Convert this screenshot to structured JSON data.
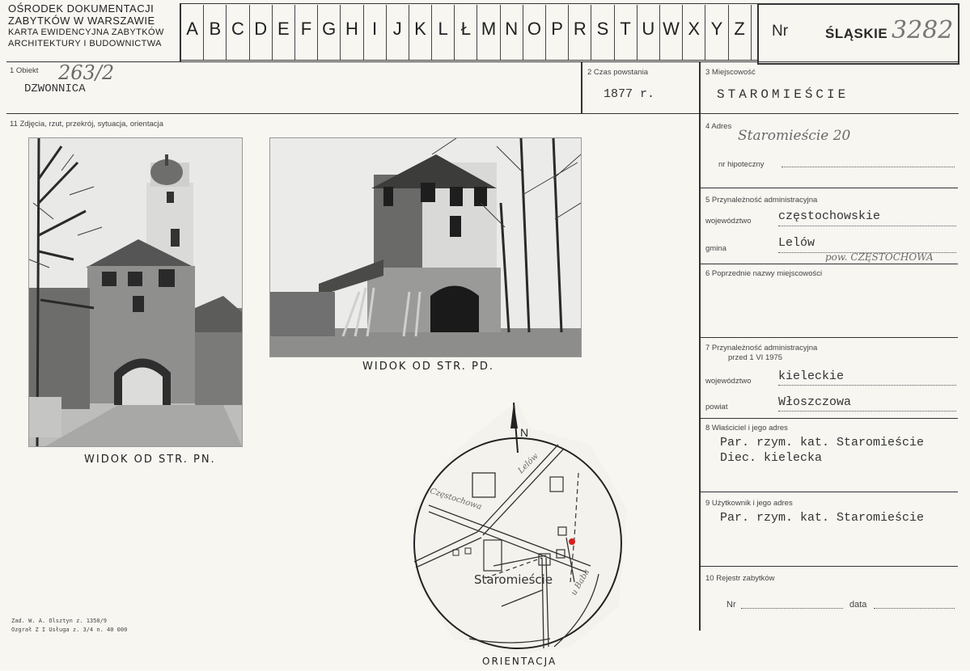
{
  "header": {
    "line1": "OŚRODEK DOKUMENTACJI",
    "line2": "ZABYTKÓW W WARSZAWIE",
    "line3": "KARTA EWIDENCYJNA ZABYTKÓW",
    "line4": "ARCHITEKTURY I BUDOWNICTWA"
  },
  "alphabet": [
    "A",
    "B",
    "C",
    "D",
    "E",
    "F",
    "G",
    "H",
    "I",
    "J",
    "K",
    "L",
    "Ł",
    "M",
    "N",
    "O",
    "P",
    "R",
    "S",
    "T",
    "U",
    "W",
    "X",
    "Y",
    "Z"
  ],
  "nr_box": {
    "label": "Nr",
    "region": "ŚLĄSKIE",
    "number": "3282"
  },
  "field1": {
    "label": "1 Obiekt",
    "handwritten": "263/2",
    "value": "DZWONNICA"
  },
  "field2": {
    "label": "2 Czas powstania",
    "value": "1877 r."
  },
  "field3": {
    "label": "3 Miejscowość",
    "value": "STAROMIEŚCIE"
  },
  "field11": {
    "label": "11 Zdjęcia, rzut, przekrój, sytuacja, orientacja"
  },
  "field4": {
    "label": "4 Adres",
    "value": "Staromieście 20",
    "sub_label": "nr hipoteczny"
  },
  "field5": {
    "label": "5 Przynależność administracyjna",
    "woj_label": "województwo",
    "woj_value": "częstochowskie",
    "gmina_label": "gmina",
    "gmina_value": "Lelów",
    "pow_note": "pow. CZĘSTOCHOWA"
  },
  "field6": {
    "label": "6 Poprzednie nazwy miejscowości"
  },
  "field7": {
    "label": "7 Przynależność administracyjna",
    "label2": "przed 1 VI 1975",
    "woj_label": "województwo",
    "woj_value": "kieleckie",
    "pow_label": "powiat",
    "pow_value": "Włoszczowa"
  },
  "field8": {
    "label": "8 Właściciel i jego adres",
    "line1": "Par. rzym. kat. Staromieście",
    "line2": "Diec. kielecka"
  },
  "field9": {
    "label": "9 Użytkownik i jego adres",
    "line1": "Par. rzym. kat. Staromieście"
  },
  "field10": {
    "label": "10 Rejestr zabytków",
    "nr_label": "Nr",
    "data_label": "data"
  },
  "photo1_caption": "WIDOK OD STR. PN.",
  "photo2_caption": "WIDOK OD STR. PD.",
  "map": {
    "caption": "ORIENTACJA",
    "north": "N",
    "road_lelow": "Lelów",
    "road_czestochowa": "Częstochowa",
    "road_baba": "u Baba",
    "village": "Staromieście"
  },
  "footer": {
    "line1": "Zad. W. A. Olsztyn z. 1350/9",
    "line2": "Ozgrał Z I Usługa z. 3/4 n. 40 000"
  },
  "colors": {
    "paper": "#f7f6f1",
    "ink": "#2a2a2a",
    "marker": "#d62020"
  }
}
